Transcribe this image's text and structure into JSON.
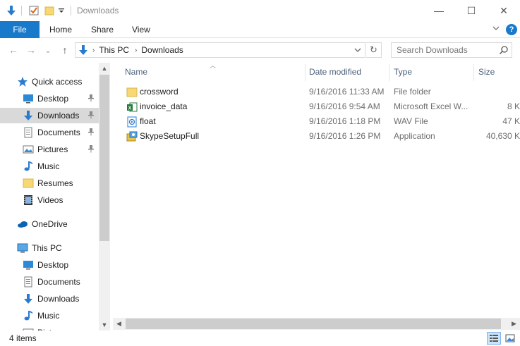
{
  "window": {
    "title": "Downloads",
    "minimize_glyph": "—",
    "maximize_glyph": "☐",
    "close_glyph": "✕"
  },
  "quick_access_toolbar": {
    "icons": [
      "down-arrow-icon",
      "properties-checkmark-icon",
      "new-folder-icon",
      "customize-dropdown-icon"
    ]
  },
  "ribbon": {
    "tabs": [
      {
        "label": "File",
        "active": true
      },
      {
        "label": "Home"
      },
      {
        "label": "Share"
      },
      {
        "label": "View"
      }
    ],
    "help_glyph": "?"
  },
  "address": {
    "breadcrumbs": [
      "This PC",
      "Downloads"
    ],
    "dropdown_glyph": "⌵",
    "refresh_glyph": "↻",
    "search_placeholder": "Search Downloads"
  },
  "nav": {
    "back_glyph": "←",
    "forward_glyph": "→",
    "recent_glyph": "⌄",
    "up_glyph": "↑"
  },
  "navpane": {
    "items": [
      {
        "label": "Quick access",
        "icon": "star-icon",
        "level": 0,
        "pinned": false
      },
      {
        "label": "Desktop",
        "icon": "desktop-icon",
        "level": 1,
        "pinned": true
      },
      {
        "label": "Downloads",
        "icon": "download-arrow-icon",
        "level": 1,
        "pinned": true,
        "selected": true
      },
      {
        "label": "Documents",
        "icon": "documents-icon",
        "level": 1,
        "pinned": true
      },
      {
        "label": "Pictures",
        "icon": "pictures-icon",
        "level": 1,
        "pinned": true
      },
      {
        "label": "Music",
        "icon": "music-note-icon",
        "level": 1,
        "pinned": false
      },
      {
        "label": "Resumes",
        "icon": "folder-icon",
        "level": 1,
        "pinned": false
      },
      {
        "label": "Videos",
        "icon": "film-icon",
        "level": 1,
        "pinned": false
      },
      {
        "label": "OneDrive",
        "icon": "cloud-icon",
        "level": 0,
        "pinned": false
      },
      {
        "label": "This PC",
        "icon": "computer-icon",
        "level": 0,
        "pinned": false
      },
      {
        "label": "Desktop",
        "icon": "desktop-icon",
        "level": 1,
        "pinned": false
      },
      {
        "label": "Documents",
        "icon": "documents-icon",
        "level": 1,
        "pinned": false
      },
      {
        "label": "Downloads",
        "icon": "download-arrow-icon",
        "level": 1,
        "pinned": false
      },
      {
        "label": "Music",
        "icon": "music-note-icon",
        "level": 1,
        "pinned": false
      },
      {
        "label": "Pictures",
        "icon": "pictures-icon",
        "level": 1,
        "pinned": false
      }
    ]
  },
  "columns": {
    "name": "Name",
    "date": "Date modified",
    "type": "Type",
    "size": "Size"
  },
  "files": [
    {
      "name": "crossword",
      "date": "9/16/2016 11:33 AM",
      "type": "File folder",
      "size": "",
      "icon": "folder-icon"
    },
    {
      "name": "invoice_data",
      "date": "9/16/2016 9:54 AM",
      "type": "Microsoft Excel W...",
      "size": "8 K",
      "icon": "excel-icon"
    },
    {
      "name": "float",
      "date": "9/16/2016 1:18 PM",
      "type": "WAV File",
      "size": "47 K",
      "icon": "audio-file-icon"
    },
    {
      "name": "SkypeSetupFull",
      "date": "9/16/2016 1:26 PM",
      "type": "Application",
      "size": "40,630 K",
      "icon": "installer-icon"
    }
  ],
  "status": {
    "item_count": "4 items"
  },
  "colors": {
    "accent": "#1979ca",
    "selected_nav": "#d9d9d9",
    "header_text": "#4c607a"
  }
}
